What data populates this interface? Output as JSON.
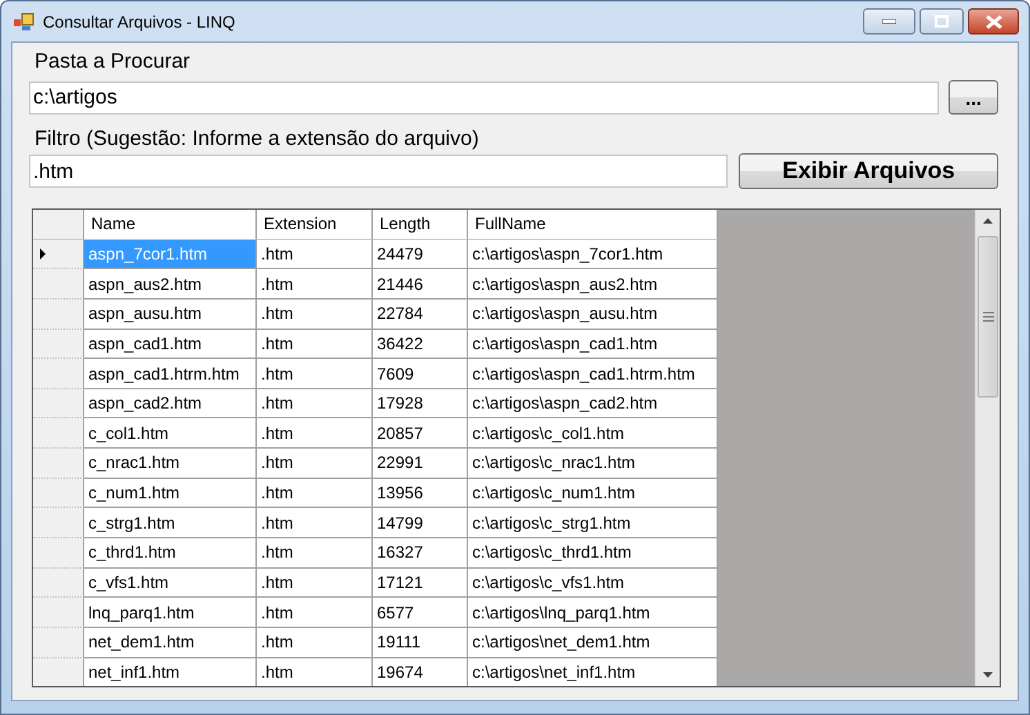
{
  "window": {
    "title": "Consultar Arquivos - LINQ"
  },
  "folder": {
    "label": "Pasta a Procurar",
    "value": "c:\\artigos",
    "browse_button": "..."
  },
  "filter": {
    "label": "Filtro (Sugestão: Informe a extensão do arquivo)",
    "value": ".htm",
    "show_button": "Exibir Arquivos"
  },
  "table": {
    "columns": [
      "Name",
      "Extension",
      "Length",
      "FullName"
    ],
    "rows": [
      {
        "cells": [
          "aspn_7cor1.htm",
          ".htm",
          "24479",
          "c:\\artigos\\aspn_7cor1.htm"
        ],
        "selected": true
      },
      {
        "cells": [
          "aspn_aus2.htm",
          ".htm",
          "21446",
          "c:\\artigos\\aspn_aus2.htm"
        ],
        "selected": false
      },
      {
        "cells": [
          "aspn_ausu.htm",
          ".htm",
          "22784",
          "c:\\artigos\\aspn_ausu.htm"
        ],
        "selected": false
      },
      {
        "cells": [
          "aspn_cad1.htm",
          ".htm",
          "36422",
          "c:\\artigos\\aspn_cad1.htm"
        ],
        "selected": false
      },
      {
        "cells": [
          "aspn_cad1.htrm.htm",
          ".htm",
          "7609",
          "c:\\artigos\\aspn_cad1.htrm.htm"
        ],
        "selected": false
      },
      {
        "cells": [
          "aspn_cad2.htm",
          ".htm",
          "17928",
          "c:\\artigos\\aspn_cad2.htm"
        ],
        "selected": false
      },
      {
        "cells": [
          "c_col1.htm",
          ".htm",
          "20857",
          "c:\\artigos\\c_col1.htm"
        ],
        "selected": false
      },
      {
        "cells": [
          "c_nrac1.htm",
          ".htm",
          "22991",
          "c:\\artigos\\c_nrac1.htm"
        ],
        "selected": false
      },
      {
        "cells": [
          "c_num1.htm",
          ".htm",
          "13956",
          "c:\\artigos\\c_num1.htm"
        ],
        "selected": false
      },
      {
        "cells": [
          "c_strg1.htm",
          ".htm",
          "14799",
          "c:\\artigos\\c_strg1.htm"
        ],
        "selected": false
      },
      {
        "cells": [
          "c_thrd1.htm",
          ".htm",
          "16327",
          "c:\\artigos\\c_thrd1.htm"
        ],
        "selected": false
      },
      {
        "cells": [
          "c_vfs1.htm",
          ".htm",
          "17121",
          "c:\\artigos\\c_vfs1.htm"
        ],
        "selected": false
      },
      {
        "cells": [
          "lnq_parq1.htm",
          ".htm",
          "6577",
          "c:\\artigos\\lnq_parq1.htm"
        ],
        "selected": false
      },
      {
        "cells": [
          "net_dem1.htm",
          ".htm",
          "19111",
          "c:\\artigos\\net_dem1.htm"
        ],
        "selected": false
      },
      {
        "cells": [
          "net_inf1.htm",
          ".htm",
          "19674",
          "c:\\artigos\\net_inf1.htm"
        ],
        "selected": false
      }
    ]
  }
}
